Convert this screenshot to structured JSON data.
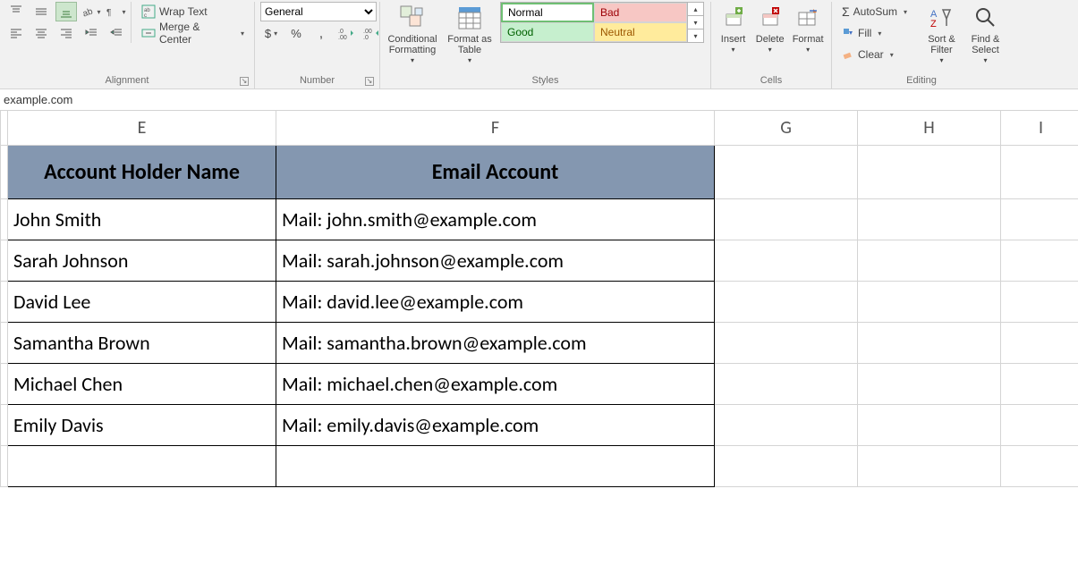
{
  "ribbon": {
    "alignment": {
      "label": "Alignment",
      "wrap_text": "Wrap Text",
      "merge_center": "Merge & Center"
    },
    "number": {
      "label": "Number",
      "format_selected": "General"
    },
    "styles": {
      "label": "Styles",
      "conditional_formatting": "Conditional Formatting",
      "format_as_table": "Format as Table",
      "normal": "Normal",
      "bad": "Bad",
      "good": "Good",
      "neutral": "Neutral"
    },
    "cells": {
      "label": "Cells",
      "insert": "Insert",
      "delete": "Delete",
      "format": "Format"
    },
    "editing": {
      "label": "Editing",
      "autosum": "AutoSum",
      "fill": "Fill",
      "clear": "Clear",
      "sort_filter": "Sort & Filter",
      "find_select": "Find & Select"
    }
  },
  "formula_bar": "example.com",
  "columns": [
    "E",
    "F",
    "G",
    "H",
    "I"
  ],
  "headers": {
    "E": "Account Holder Name",
    "F": "Email Account"
  },
  "rows": [
    {
      "E": "John Smith",
      "F": "Mail: john.smith@example.com"
    },
    {
      "E": "Sarah Johnson",
      "F": "Mail: sarah.johnson@example.com"
    },
    {
      "E": "David Lee",
      "F": "Mail: david.lee@example.com"
    },
    {
      "E": "Samantha Brown",
      "F": "Mail: samantha.brown@example.com"
    },
    {
      "E": "Michael Chen",
      "F": "Mail: michael.chen@example.com"
    },
    {
      "E": "Emily Davis",
      "F": "Mail: emily.davis@example.com"
    }
  ]
}
